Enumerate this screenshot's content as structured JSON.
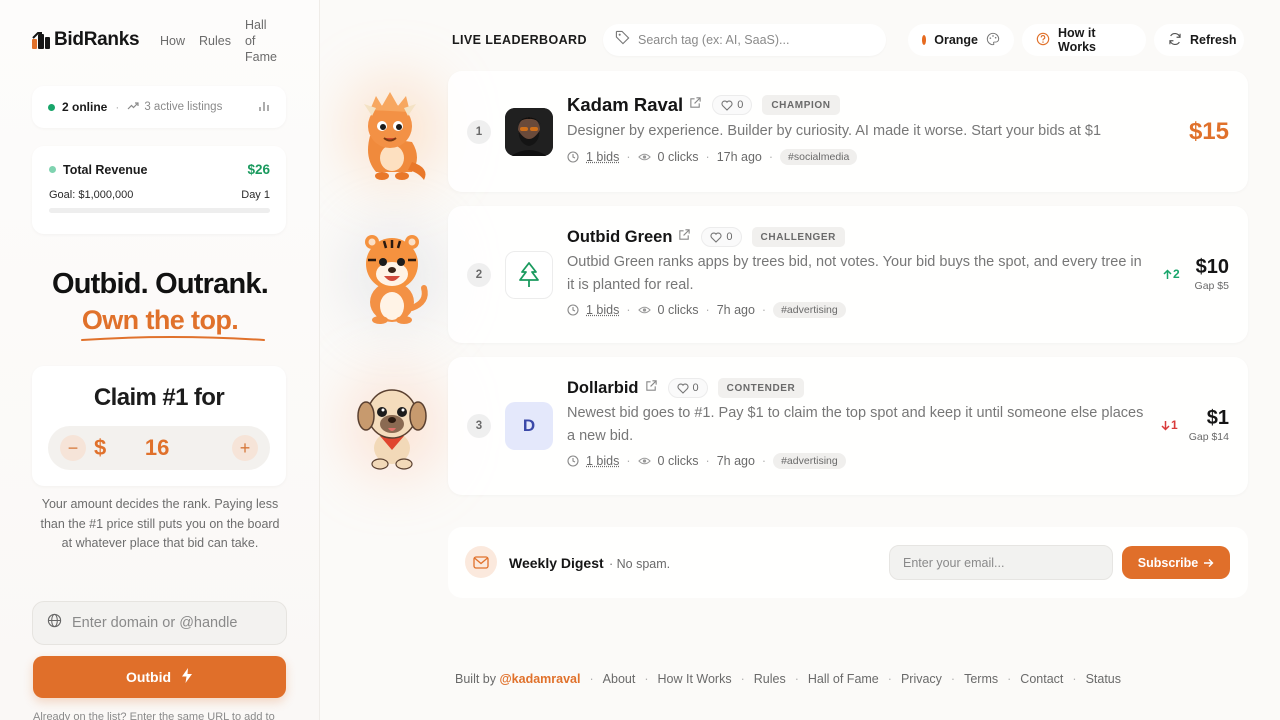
{
  "brand": {
    "name": "BidRanks"
  },
  "topnav": {
    "how": "How",
    "rules": "Rules",
    "hall_of_fame": "Hall of Fame"
  },
  "stats": {
    "online": "2 online",
    "listings": "3 active listings"
  },
  "revenue": {
    "label": "Total Revenue",
    "value": "$26",
    "goal": "Goal: $1,000,000",
    "day": "Day 1",
    "progress": 2.6e-05
  },
  "hero": {
    "line1": "Outbid. Outrank.",
    "line2": "Own the top."
  },
  "claim": {
    "title": "Claim #1 for",
    "currency": "$",
    "amount": "16",
    "minus": "−",
    "plus": "+"
  },
  "explain": "Your amount decides the rank. Paying less than the #1 price still puts you on the board at whatever place that bid can take.",
  "domain_input": {
    "placeholder": "Enter domain or @handle"
  },
  "outbid_button": "Outbid",
  "already_text": "Already on the list? Enter the same URL to add to",
  "header": {
    "leaderboard_title": "LIVE LEADERBOARD",
    "tag_search_placeholder": "Search tag (ex: AI, SaaS)...",
    "theme": "Orange",
    "how_it_works": "How it Works",
    "refresh": "Refresh"
  },
  "rows": [
    {
      "rank": "1",
      "name": "Kadam Raval",
      "likes": "0",
      "status": "CHAMPION",
      "description": "Designer by experience. Builder by curiosity. AI made it worse. Start your bids at $1",
      "bids": "1 bids",
      "clicks": "0 clicks",
      "time": "17h ago",
      "tag": "#socialmedia",
      "price": "$15",
      "gap": "",
      "delta": ""
    },
    {
      "rank": "2",
      "name": "Outbid Green",
      "likes": "0",
      "status": "CHALLENGER",
      "description": "Outbid Green ranks apps by trees bid, not votes. Your bid buys the spot, and every tree in it is planted for real.",
      "bids": "1 bids",
      "clicks": "0 clicks",
      "time": "7h ago",
      "tag": "#advertising",
      "price": "$10",
      "gap": "Gap $5",
      "delta": "2",
      "delta_dir": "up"
    },
    {
      "rank": "3",
      "name": "Dollarbid",
      "likes": "0",
      "status": "CONTENDER",
      "description": "Newest bid goes to #1. Pay $1 to claim the top spot and keep it until someone else places a new bid.",
      "bids": "1 bids",
      "clicks": "0 clicks",
      "time": "7h ago",
      "tag": "#advertising",
      "price": "$1",
      "gap": "Gap $14",
      "delta": "1",
      "delta_dir": "down",
      "avatar_letter": "D"
    }
  ],
  "digest": {
    "title": "Weekly Digest",
    "subtitle": "· No spam.",
    "email_placeholder": "Enter your email...",
    "subscribe": "Subscribe"
  },
  "footer": {
    "built_by": "Built by",
    "author": "@kadamraval",
    "links": [
      "About",
      "How It Works",
      "Rules",
      "Hall of Fame",
      "Privacy",
      "Terms",
      "Contact",
      "Status"
    ]
  },
  "colors": {
    "accent": "#e06f2a",
    "green": "#1a9a5e",
    "up": "#18a56a",
    "down": "#d93a3a"
  },
  "icons": [
    "external-link-icon",
    "heart-icon",
    "clock-icon",
    "eye-icon",
    "tag-icon",
    "globe-icon",
    "bolt-icon",
    "mail-icon",
    "palette-icon",
    "help-circle-icon",
    "refresh-icon",
    "trend-icon",
    "bar-chart-icon",
    "tree-icon"
  ]
}
